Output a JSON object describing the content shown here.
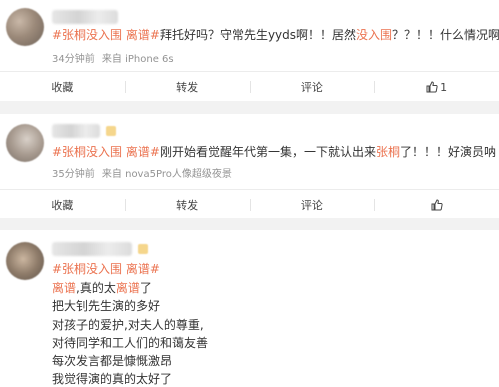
{
  "posts": [
    {
      "tags": "#张桐没入围 离谱#",
      "text_a": "拜托好吗？守常先生yyds啊！！居然",
      "highlight": "没入围",
      "text_b": "？？！！什么情况啊？？",
      "time": "34分钟前",
      "source": "来自 iPhone 6s",
      "actions": {
        "favorite": "收藏",
        "repost": "转发",
        "comment": "评论",
        "like_count": "1"
      }
    },
    {
      "tags": "#张桐没入围 离谱#",
      "text_a": "刚开始看觉醒年代第一集，一下就认出来",
      "highlight": "张桐",
      "text_b": "了！！！好演员呐",
      "time": "35分钟前",
      "source": "来自 nova5Pro人像超级夜景",
      "actions": {
        "favorite": "收藏",
        "repost": "转发",
        "comment": "评论"
      }
    },
    {
      "tags": "#张桐没入围 离谱#",
      "line1_hl1": "离谱",
      "line1_mid": ",真的太",
      "line1_hl2": "离谱",
      "line1_end": "了",
      "lines": [
        "把大钊先生演的多好",
        "对孩子的爱护,对夫人的尊重,",
        "对待同学和工人们的和蔼友善",
        "每次发言都是慷慨激昂",
        "我觉得演的真的太好了"
      ]
    }
  ],
  "colors": {
    "accent": "#eb7350",
    "text": "#333333",
    "meta": "#939393",
    "background": "#f2f2f2"
  },
  "icons": {
    "like": "thumbs-up-icon"
  }
}
